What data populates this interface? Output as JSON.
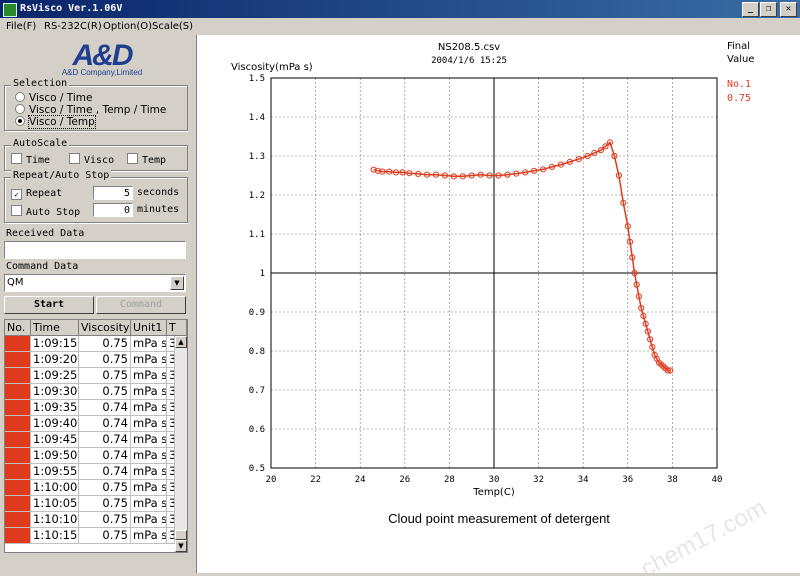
{
  "window": {
    "title": "RsVisco Ver.1.06V",
    "minimize_glyph": "_",
    "restore_glyph": "❐",
    "close_glyph": "✕"
  },
  "menu": [
    "File(F)",
    "RS-232C(R)",
    "Option(O)",
    "Scale(S)"
  ],
  "logo": {
    "main": "A&D",
    "sub": "A&D Company,Limited"
  },
  "selection": {
    "label": "Selection",
    "options": [
      "Visco / Time",
      "Visco / Time , Temp / Time",
      "Visco / Temp"
    ],
    "selected_index": 2
  },
  "autoscale": {
    "label": "AutoScale",
    "items": [
      {
        "label": "Time",
        "checked": false
      },
      {
        "label": "Visco",
        "checked": false
      },
      {
        "label": "Temp",
        "checked": false
      }
    ]
  },
  "repeat": {
    "label": "Repeat/Auto Stop",
    "repeat_label": "Repeat",
    "repeat_checked": true,
    "repeat_value": "5",
    "repeat_unit": "seconds",
    "autostop_label": "Auto Stop",
    "autostop_checked": false,
    "autostop_value": "0",
    "autostop_unit": "minutes"
  },
  "received": {
    "label": "Received Data",
    "value": ""
  },
  "command": {
    "label": "Command Data",
    "value": "QM"
  },
  "buttons": {
    "start": "Start",
    "command": "Command"
  },
  "table": {
    "headers": [
      "No.",
      "Time",
      "Viscosity",
      "Unit1",
      "T"
    ],
    "row_marker_color": "#e03a1e",
    "rows": [
      {
        "no": "",
        "time": "1:09:15",
        "visc": "0.75",
        "unit": "mPa s",
        "t": "3"
      },
      {
        "no": "",
        "time": "1:09:20",
        "visc": "0.75",
        "unit": "mPa s",
        "t": "3"
      },
      {
        "no": "",
        "time": "1:09:25",
        "visc": "0.75",
        "unit": "mPa s",
        "t": "3"
      },
      {
        "no": "",
        "time": "1:09:30",
        "visc": "0.75",
        "unit": "mPa s",
        "t": "3"
      },
      {
        "no": "",
        "time": "1:09:35",
        "visc": "0.74",
        "unit": "mPa s",
        "t": "3"
      },
      {
        "no": "",
        "time": "1:09:40",
        "visc": "0.74",
        "unit": "mPa s",
        "t": "3"
      },
      {
        "no": "",
        "time": "1:09:45",
        "visc": "0.74",
        "unit": "mPa s",
        "t": "3"
      },
      {
        "no": "",
        "time": "1:09:50",
        "visc": "0.74",
        "unit": "mPa s",
        "t": "3"
      },
      {
        "no": "",
        "time": "1:09:55",
        "visc": "0.74",
        "unit": "mPa s",
        "t": "3"
      },
      {
        "no": "",
        "time": "1:10:00",
        "visc": "0.75",
        "unit": "mPa s",
        "t": "3"
      },
      {
        "no": "",
        "time": "1:10:05",
        "visc": "0.75",
        "unit": "mPa s",
        "t": "3"
      },
      {
        "no": "",
        "time": "1:10:10",
        "visc": "0.75",
        "unit": "mPa s",
        "t": "3"
      },
      {
        "no": "",
        "time": "1:10:15",
        "visc": "0.75",
        "unit": "mPa s",
        "t": "3"
      }
    ]
  },
  "plot": {
    "filename": "NS208.5.csv",
    "datetime": "2004/1/6 15:25",
    "final_value_label": [
      "Final",
      "Value"
    ],
    "series_label": "No.1",
    "series_value": "0.75",
    "caption": "Cloud point measurement of detergent",
    "watermark": "chem17.com",
    "series_color": "#e03a1e"
  },
  "chart_data": {
    "type": "scatter",
    "title": "NS208.5.csv",
    "subtitle": "2004/1/6 15:25",
    "xlabel": "Temp(C)",
    "ylabel": "Viscosity(mPa s)",
    "xlim": [
      20,
      40
    ],
    "ylim": [
      0.5,
      1.5
    ],
    "xticks": [
      "20",
      "22",
      "24",
      "26",
      "28",
      "30",
      "32",
      "34",
      "36",
      "38",
      "40"
    ],
    "yticks": [
      "0.5",
      "0.6",
      "0.7",
      "0.8",
      "0.9",
      "1",
      "1.1",
      "1.2",
      "1.3",
      "1.4",
      "1.5"
    ],
    "grid": true,
    "series": [
      {
        "name": "No.1",
        "x": [
          24.6,
          24.8,
          25.0,
          25.3,
          25.6,
          25.9,
          26.2,
          26.6,
          27.0,
          27.4,
          27.8,
          28.2,
          28.6,
          29.0,
          29.4,
          29.8,
          30.2,
          30.6,
          31.0,
          31.4,
          31.8,
          32.2,
          32.6,
          33.0,
          33.4,
          33.8,
          34.2,
          34.5,
          34.8,
          35.0,
          35.2,
          35.4,
          35.6,
          35.8,
          36.0,
          36.1,
          36.2,
          36.3,
          36.4,
          36.5,
          36.6,
          36.7,
          36.8,
          36.9,
          37.0,
          37.1,
          37.2,
          37.3,
          37.4,
          37.5,
          37.6,
          37.7,
          37.8,
          37.9
        ],
        "y": [
          1.265,
          1.262,
          1.26,
          1.26,
          1.258,
          1.258,
          1.256,
          1.254,
          1.252,
          1.252,
          1.25,
          1.248,
          1.248,
          1.25,
          1.252,
          1.25,
          1.25,
          1.252,
          1.255,
          1.258,
          1.262,
          1.266,
          1.272,
          1.278,
          1.285,
          1.292,
          1.3,
          1.308,
          1.315,
          1.325,
          1.335,
          1.3,
          1.25,
          1.18,
          1.12,
          1.08,
          1.04,
          1.0,
          0.97,
          0.94,
          0.91,
          0.89,
          0.87,
          0.85,
          0.83,
          0.81,
          0.79,
          0.78,
          0.77,
          0.765,
          0.76,
          0.755,
          0.75,
          0.75
        ]
      }
    ]
  }
}
